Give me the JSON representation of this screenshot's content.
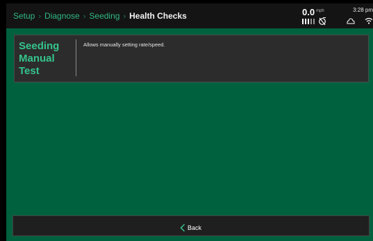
{
  "breadcrumb": {
    "items": [
      "Setup",
      "Diagnose",
      "Seeding"
    ],
    "current": "Health Checks",
    "separator": "›"
  },
  "status": {
    "speed_value": "0.0",
    "speed_unit": "mph",
    "time": "3:28 pm",
    "icons": [
      "signal-bars-icon",
      "gps-icon",
      "cloud-icon",
      "wifi-icon"
    ]
  },
  "test_panel": {
    "title_lines": [
      "Seeding",
      "Manual",
      "Test"
    ],
    "description": "Allows manually setting rate/speed."
  },
  "footer": {
    "back_label": "Back",
    "back_icon": "chevron-left-icon"
  },
  "colors": {
    "background": "#00613f",
    "topbar": "#141414",
    "accent": "#34c48c",
    "panel": "#2c2c2c",
    "footer_bar": "#1f1f1f"
  }
}
